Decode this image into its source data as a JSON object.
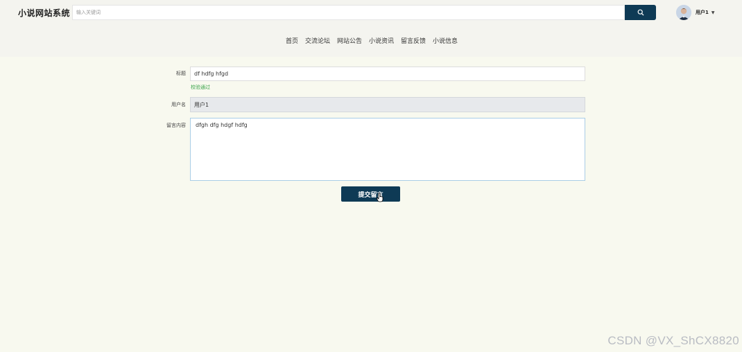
{
  "header": {
    "logo": "小说网站系统",
    "search": {
      "placeholder": "输入关键词"
    },
    "user": {
      "name": "用户1"
    }
  },
  "nav": {
    "items": [
      {
        "label": "首页"
      },
      {
        "label": "交流论坛"
      },
      {
        "label": "网站公告"
      },
      {
        "label": "小说资讯"
      },
      {
        "label": "留言反馈"
      },
      {
        "label": "小说信息"
      }
    ]
  },
  "form": {
    "title": {
      "label": "标题",
      "value": "df hdfg hfgd",
      "validation": "校验通过"
    },
    "username": {
      "label": "用户名",
      "value": "用户1"
    },
    "content": {
      "label": "留言内容",
      "value": "dfgh dfg hdgf hdfg"
    },
    "submit_label": "提交留言"
  },
  "watermark": "CSDN @VX_ShCX8820",
  "colors": {
    "accent": "#0e3a55",
    "success": "#3aa34a",
    "page_bg": "#f8f9ef"
  }
}
